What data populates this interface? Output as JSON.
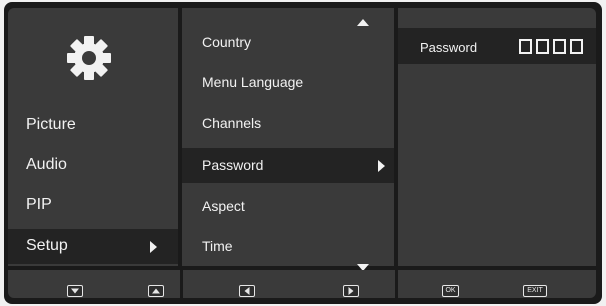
{
  "left_menu": {
    "items": [
      {
        "label": "Picture"
      },
      {
        "label": "Audio"
      },
      {
        "label": "PIP"
      },
      {
        "label": "Setup"
      }
    ],
    "selected": "Setup",
    "header_icon": "gear-icon"
  },
  "mid_menu": {
    "items": [
      {
        "label": "Country"
      },
      {
        "label": "Menu Language"
      },
      {
        "label": "Channels"
      },
      {
        "label": "Password"
      },
      {
        "label": "Aspect"
      },
      {
        "label": "Time"
      }
    ],
    "selected": "Password",
    "scroll_icons": [
      "arrow-up-icon",
      "arrow-down-icon"
    ]
  },
  "right_panel": {
    "field_label": "Password",
    "digit_boxes": 4
  },
  "bottom_bar": {
    "buttons": [
      {
        "icon": "down-key-icon",
        "label": ""
      },
      {
        "icon": "up-key-icon",
        "label": ""
      },
      {
        "icon": "left-key-icon",
        "label": ""
      },
      {
        "icon": "right-key-icon",
        "label": ""
      },
      {
        "icon": "ok-key-icon",
        "label": "OK"
      },
      {
        "icon": "exit-key-icon",
        "label": "EXIT"
      }
    ]
  },
  "colors": {
    "panel": "#3a3a3a",
    "selected": "#232323",
    "border": "#1a1a1a",
    "text": "#f2f2f2"
  }
}
